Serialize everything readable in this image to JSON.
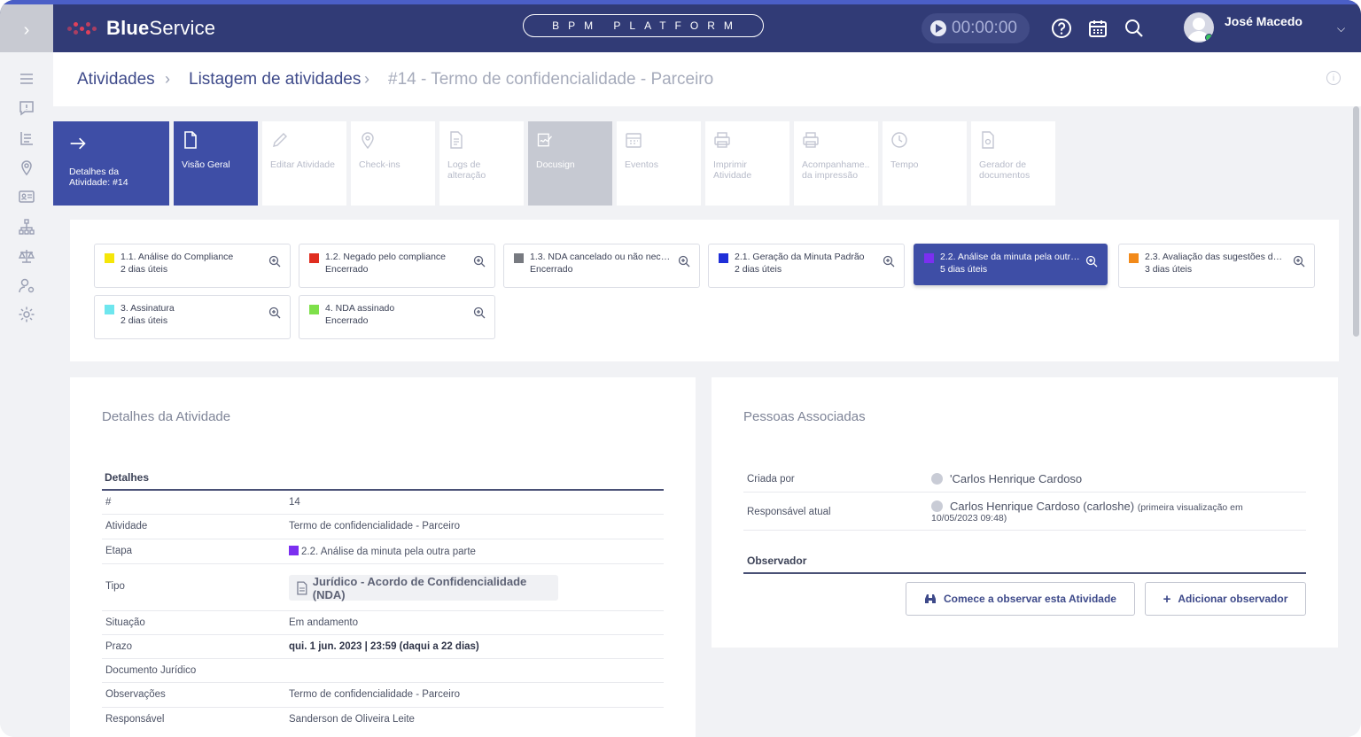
{
  "header": {
    "logo_bold": "Blue",
    "logo_light": "Service",
    "platform_label": "BPM PLATFORM",
    "timer": "00:00:00",
    "user_name": "José Macedo"
  },
  "breadcrumb": {
    "items": [
      "Atividades",
      "Listagem de atividades"
    ],
    "current": "#14 - Termo de confidencialidade - Parceiro"
  },
  "tools": {
    "detail_label": "Detalhes da Atividade: #14",
    "items": [
      {
        "label": "Visão Geral"
      },
      {
        "label": "Editar Atividade"
      },
      {
        "label": "Check-ins"
      },
      {
        "label": "Logs de alteração"
      },
      {
        "label": "Docusign"
      },
      {
        "label": "Eventos"
      },
      {
        "label": "Imprimir Atividade"
      },
      {
        "label": "Acompanhame.. da impressão"
      },
      {
        "label": "Tempo"
      },
      {
        "label": "Gerador de documentos"
      }
    ]
  },
  "stages": [
    {
      "title": "1.1. Análise do Compliance",
      "sub": "2 dias úteis",
      "color": "#f5e609"
    },
    {
      "title": "1.2. Negado pelo compliance",
      "sub": "Encerrado",
      "color": "#e02d1f"
    },
    {
      "title": "1.3. NDA cancelado ou não necessá...",
      "sub": "Encerrado",
      "color": "#777a80"
    },
    {
      "title": "2.1. Geração da Minuta Padrão",
      "sub": "2 dias úteis",
      "color": "#1f2fd8"
    },
    {
      "title": "2.2. Análise da minuta pela outra p...",
      "sub": "5 dias úteis",
      "color": "#7b2ff0"
    },
    {
      "title": "2.3. Avaliação das sugestões da ou...",
      "sub": "3 dias úteis",
      "color": "#f28a1a"
    },
    {
      "title": "3. Assinatura",
      "sub": "2 dias úteis",
      "color": "#6ee6ee"
    },
    {
      "title": "4. NDA assinado",
      "sub": "Encerrado",
      "color": "#7ee04a"
    }
  ],
  "details": {
    "title": "Detalhes da Atividade",
    "table_head": "Detalhes",
    "rows": [
      {
        "label": "#",
        "value": "14"
      },
      {
        "label": "Atividade",
        "value": "Termo de confidencialidade - Parceiro"
      },
      {
        "label": "Etapa",
        "value": "2.2. Análise da minuta pela outra parte"
      },
      {
        "label": "Tipo",
        "value": "Jurídico - Acordo de Confidencialidade (NDA)"
      },
      {
        "label": "Situação",
        "value": "Em andamento"
      },
      {
        "label": "Prazo",
        "value": "qui. 1 jun. 2023 | 23:59 (daqui a 22 dias)"
      },
      {
        "label": "Documento Jurídico",
        "value": ""
      },
      {
        "label": "Observações",
        "value": "Termo de confidencialidade - Parceiro"
      },
      {
        "label": "Responsável",
        "value": "Sanderson de Oliveira Leite"
      }
    ]
  },
  "people": {
    "title": "Pessoas Associadas",
    "created_by_label": "Criada por",
    "created_by": "'Carlos Henrique Cardoso",
    "responsible_label": "Responsável atual",
    "responsible": "Carlos Henrique Cardoso (carloshe)",
    "responsible_note": "(primeira visualização em",
    "responsible_date": "10/05/2023 09:48)",
    "observer_head": "Observador",
    "observe_button": "Comece a observar esta Atividade",
    "add_observer_button": "Adicionar observador"
  }
}
